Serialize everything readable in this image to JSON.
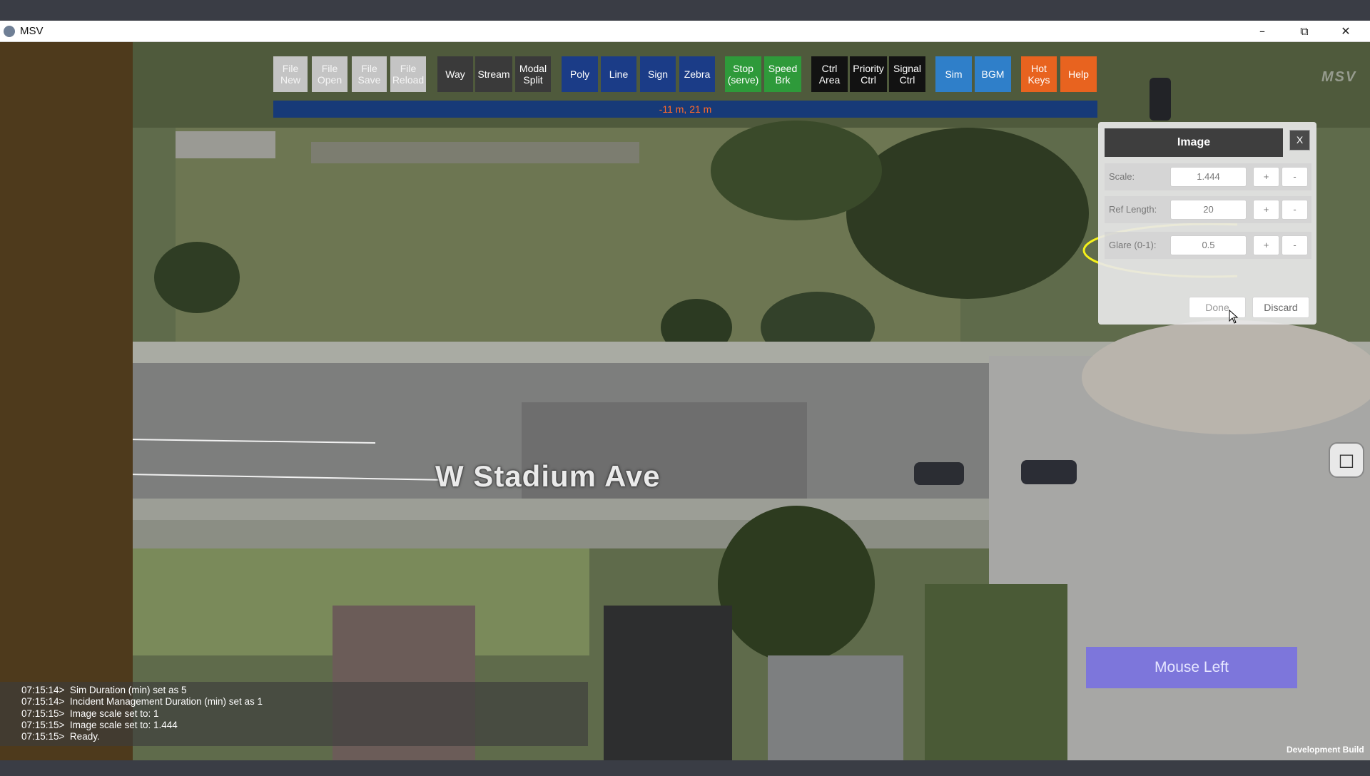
{
  "window": {
    "title": "MSV",
    "minimize_icon": "minimize-icon",
    "restore_icon": "restore-icon",
    "close_icon": "close-icon"
  },
  "toolbar": {
    "buttons": [
      {
        "label": "File\nNew",
        "bg": "#c4c4c4",
        "fg": "#f5f5f5"
      },
      {
        "label": "File\nOpen",
        "bg": "#c4c4c4",
        "fg": "#f5f5f5"
      },
      {
        "label": "File\nSave",
        "bg": "#c4c4c4",
        "fg": "#f5f5f5"
      },
      {
        "label": "File\nReload",
        "bg": "#c4c4c4",
        "fg": "#f5f5f5"
      },
      {
        "label": "Way",
        "bg": "#3a3a3a",
        "fg": "#ffffff"
      },
      {
        "label": "Stream",
        "bg": "#3a3a3a",
        "fg": "#ffffff"
      },
      {
        "label": "Modal\nSplit",
        "bg": "#3a3a3a",
        "fg": "#ffffff"
      },
      {
        "label": "Poly",
        "bg": "#1b3c87",
        "fg": "#ffffff"
      },
      {
        "label": "Line",
        "bg": "#1b3c87",
        "fg": "#ffffff"
      },
      {
        "label": "Sign",
        "bg": "#1b3c87",
        "fg": "#ffffff"
      },
      {
        "label": "Zebra",
        "bg": "#1b3c87",
        "fg": "#ffffff"
      },
      {
        "label": "Stop\n(serve)",
        "bg": "#2e9a3a",
        "fg": "#ffffff"
      },
      {
        "label": "Speed\nBrk",
        "bg": "#2e9a3a",
        "fg": "#ffffff"
      },
      {
        "label": "Ctrl\nArea",
        "bg": "#121212",
        "fg": "#ffffff"
      },
      {
        "label": "Priority\nCtrl",
        "bg": "#121212",
        "fg": "#ffffff"
      },
      {
        "label": "Signal\nCtrl",
        "bg": "#121212",
        "fg": "#ffffff"
      },
      {
        "label": "Sim",
        "bg": "#2f7fc9",
        "fg": "#ffffff"
      },
      {
        "label": "BGM",
        "bg": "#2f7fc9",
        "fg": "#ffffff"
      },
      {
        "label": "Hot\nKeys",
        "bg": "#e8631f",
        "fg": "#ffffff"
      },
      {
        "label": "Help",
        "bg": "#e8631f",
        "fg": "#ffffff"
      }
    ]
  },
  "coordinate_readout": "-11 m, 21 m",
  "logo_text": "MSV",
  "image_panel": {
    "title": "Image",
    "close_label": "X",
    "rows": [
      {
        "label": "Scale:",
        "value": "1.444",
        "plus": "+",
        "minus": "-"
      },
      {
        "label": "Ref Length:",
        "value": "20",
        "plus": "+",
        "minus": "-"
      },
      {
        "label": "Glare (0-1):",
        "value": "0.5",
        "plus": "+",
        "minus": "-"
      }
    ],
    "done_label": "Done",
    "discard_label": "Discard"
  },
  "map": {
    "street_label": "W Stadium Ave",
    "bus_icon": "bus-icon"
  },
  "log": {
    "lines": [
      "07:15:14>  Sim Duration (min) set as 5",
      "07:15:14>  Incident Management Duration (min) set as 1",
      "07:15:15>  Image scale set to: 1",
      "07:15:15>  Image scale set to: 1.444",
      "07:15:15>  Ready."
    ]
  },
  "mouse_indicator": "Mouse Left",
  "build_label": "Development Build",
  "colors": {
    "highlight_ellipse": "#f5f01a",
    "left_strip": "#4e3a1c",
    "coord_bar": "#173a78",
    "coord_text": "#ff6a2a"
  }
}
